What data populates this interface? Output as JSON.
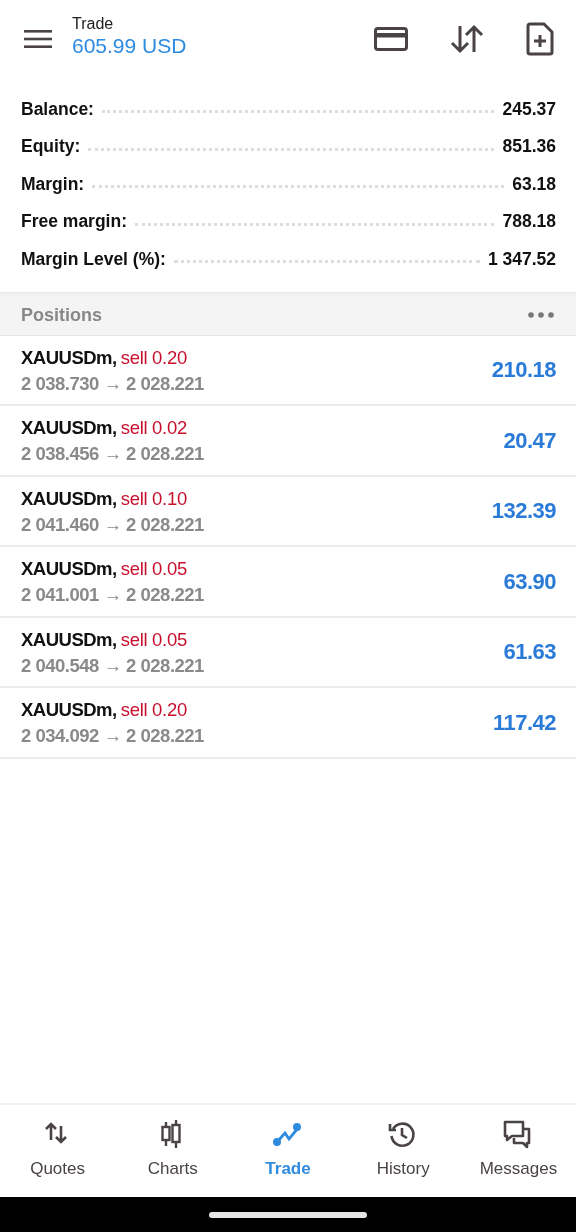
{
  "header": {
    "title": "Trade",
    "balance": "605.99 USD"
  },
  "summary": [
    {
      "label": "Balance:",
      "value": "245.37"
    },
    {
      "label": "Equity:",
      "value": "851.36"
    },
    {
      "label": "Margin:",
      "value": "63.18"
    },
    {
      "label": "Free margin:",
      "value": "788.18"
    },
    {
      "label": "Margin Level (%):",
      "value": "1 347.52"
    }
  ],
  "positions_header": {
    "title": "Positions"
  },
  "positions": [
    {
      "symbol": "XAUUSDm,",
      "trade": "sell 0.20",
      "prices": "2 038.730 → 2 028.221",
      "profit": "210.18"
    },
    {
      "symbol": "XAUUSDm,",
      "trade": "sell 0.02",
      "prices": "2 038.456 → 2 028.221",
      "profit": "20.47"
    },
    {
      "symbol": "XAUUSDm,",
      "trade": "sell 0.10",
      "prices": "2 041.460 → 2 028.221",
      "profit": "132.39"
    },
    {
      "symbol": "XAUUSDm,",
      "trade": "sell 0.05",
      "prices": "2 041.001 → 2 028.221",
      "profit": "63.90"
    },
    {
      "symbol": "XAUUSDm,",
      "trade": "sell 0.05",
      "prices": "2 040.548 → 2 028.221",
      "profit": "61.63"
    },
    {
      "symbol": "XAUUSDm,",
      "trade": "sell 0.20",
      "prices": "2 034.092 → 2 028.221",
      "profit": "117.42"
    }
  ],
  "nav": [
    {
      "kind": "quotes",
      "label": "Quotes",
      "selected": false
    },
    {
      "kind": "charts",
      "label": "Charts",
      "selected": false
    },
    {
      "kind": "trade",
      "label": "Trade",
      "selected": true
    },
    {
      "kind": "history",
      "label": "History",
      "selected": false
    },
    {
      "kind": "messages",
      "label": "Messages",
      "selected": false
    }
  ]
}
